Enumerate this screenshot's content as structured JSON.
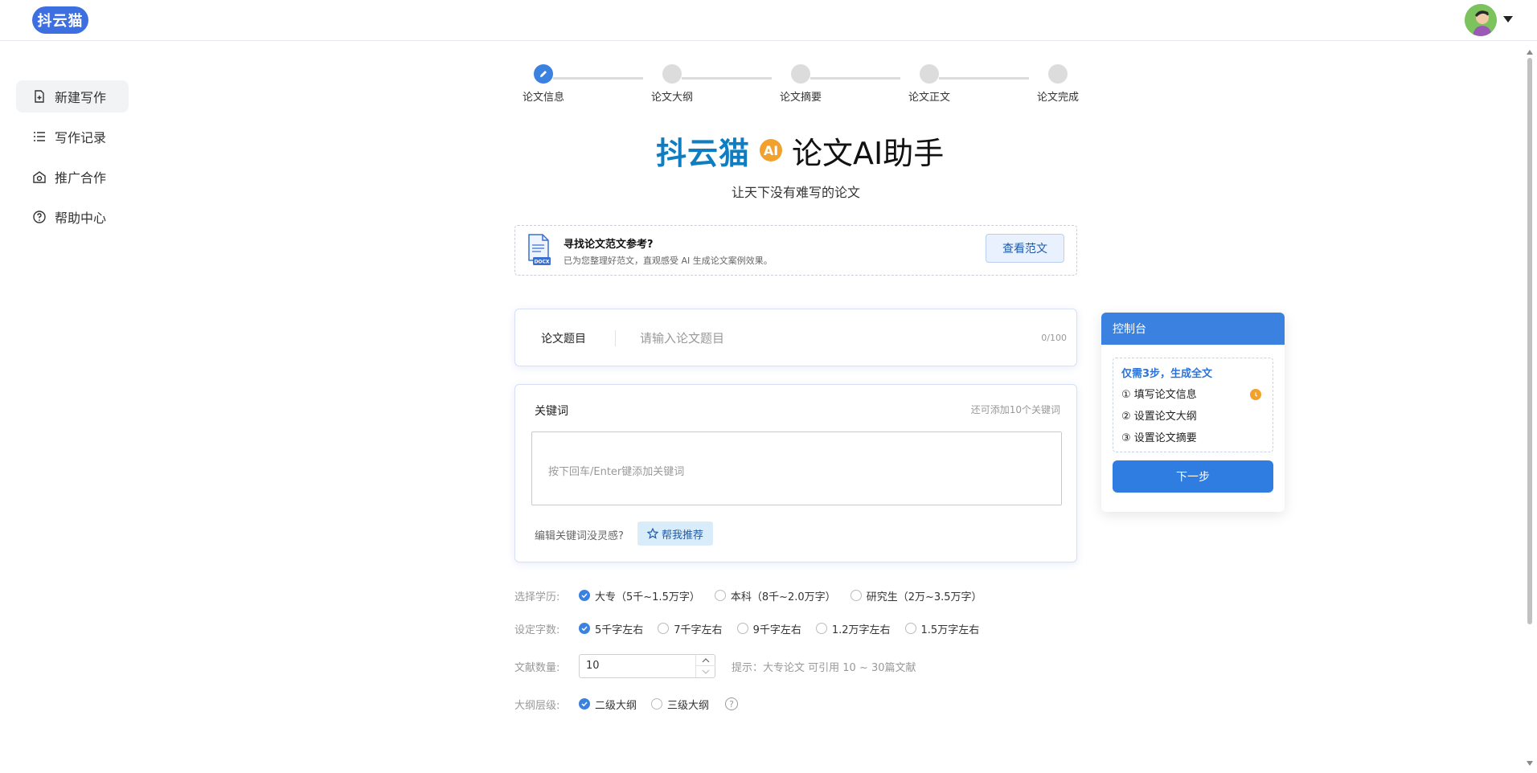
{
  "header": {
    "logo_text": "抖云猫",
    "avatar_icon": "user-avatar",
    "menu_icon": "caret-down-icon"
  },
  "sidebar": {
    "items": [
      {
        "label": "新建写作",
        "icon": "new-document-icon",
        "active": true
      },
      {
        "label": "写作记录",
        "icon": "list-icon",
        "active": false
      },
      {
        "label": "推广合作",
        "icon": "promotion-icon",
        "active": false
      },
      {
        "label": "帮助中心",
        "icon": "help-icon",
        "active": false
      }
    ]
  },
  "steps": [
    {
      "label": "论文信息",
      "active": true
    },
    {
      "label": "论文大纲",
      "active": false
    },
    {
      "label": "论文摘要",
      "active": false
    },
    {
      "label": "论文正文",
      "active": false
    },
    {
      "label": "论文完成",
      "active": false
    }
  ],
  "hero": {
    "brand": "抖云猫",
    "ai_badge": "AI",
    "subtitle": "论文AI助手",
    "tagline": "让天下没有难写的论文"
  },
  "reference": {
    "title": "寻找论文范文参考?",
    "description": "已为您整理好范文，直观感受 AI 生成论文案例效果。",
    "button": "查看范文",
    "icon_text": "DOCX"
  },
  "topic": {
    "label": "论文题目",
    "placeholder": "请输入论文题目",
    "value": "",
    "count": "0/100"
  },
  "keywords": {
    "title": "关键词",
    "limit_text": "还可添加10个关键词",
    "placeholder": "按下回车/Enter键添加关键词",
    "hint": "编辑关键词没灵感?",
    "recommend_button": "帮我推荐"
  },
  "education": {
    "label": "选择学历:",
    "options": [
      {
        "text": "大专（5千~1.5万字）",
        "selected": true
      },
      {
        "text": "本科（8千~2.0万字）",
        "selected": false
      },
      {
        "text": "研究生（2万~3.5万字）",
        "selected": false
      }
    ]
  },
  "word_count": {
    "label": "设定字数:",
    "options": [
      {
        "text": "5千字左右",
        "selected": true
      },
      {
        "text": "7千字左右",
        "selected": false
      },
      {
        "text": "9千字左右",
        "selected": false
      },
      {
        "text": "1.2万字左右",
        "selected": false
      },
      {
        "text": "1.5万字左右",
        "selected": false
      }
    ]
  },
  "references_count": {
    "label": "文献数量:",
    "value": "10",
    "tip": "提示：大专论文 可引用 10 ~ 30篇文献"
  },
  "outline_level": {
    "label": "大纲层级:",
    "options": [
      {
        "text": "二级大纲",
        "selected": true
      },
      {
        "text": "三级大纲",
        "selected": false
      }
    ],
    "help_icon": "question-circle-icon"
  },
  "console": {
    "title": "控制台",
    "box_title": "仅需3步，生成全文",
    "steps": [
      "① 填写论文信息",
      "② 设置论文大纲",
      "③ 设置论文摘要"
    ],
    "next_button": "下一步"
  },
  "colors": {
    "primary": "#3b82e0",
    "brand": "#0f7dc2",
    "accent": "#f2a12d"
  }
}
